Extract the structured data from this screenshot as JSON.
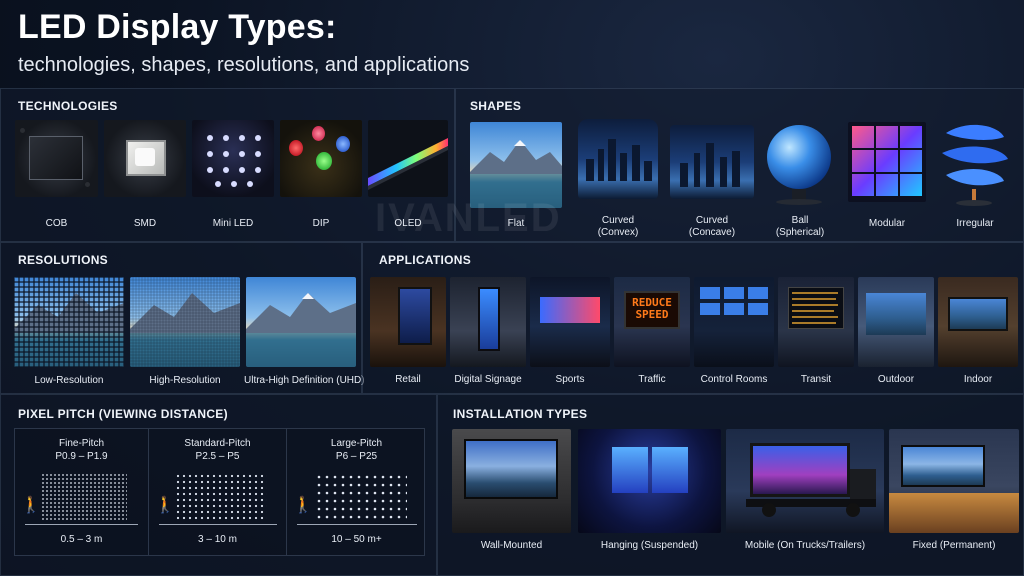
{
  "header": {
    "title": "LED Display Types:",
    "subtitle": "technologies, shapes, resolutions, and applications"
  },
  "watermark": "IVANLED",
  "technologies": {
    "title": "TECHNOLOGIES",
    "items": [
      {
        "label": "COB",
        "icon": "cob-chip-icon"
      },
      {
        "label": "SMD",
        "icon": "smd-chip-icon"
      },
      {
        "label": "Mini LED",
        "icon": "mini-led-icon"
      },
      {
        "label": "DIP",
        "icon": "dip-led-icon"
      },
      {
        "label": "OLED",
        "icon": "oled-panel-icon"
      }
    ]
  },
  "shapes": {
    "title": "SHAPES",
    "items": [
      {
        "label": "Flat",
        "sub": ""
      },
      {
        "label": "Curved",
        "sub": "(Convex)"
      },
      {
        "label": "Curved",
        "sub": "(Concave)"
      },
      {
        "label": "Ball",
        "sub": "(Spherical)"
      },
      {
        "label": "Modular",
        "sub": ""
      },
      {
        "label": "Irregular",
        "sub": ""
      }
    ]
  },
  "resolutions": {
    "title": "RESOLUTIONS",
    "items": [
      {
        "label": "Low-Resolution"
      },
      {
        "label": "High-Resolution"
      },
      {
        "label": "Ultra-High Definition (UHD)"
      }
    ]
  },
  "applications": {
    "title": "APPLICATIONS",
    "items": [
      {
        "label": "Retail"
      },
      {
        "label": "Digital Signage"
      },
      {
        "label": "Sports"
      },
      {
        "label": "Traffic"
      },
      {
        "label": "Control Rooms"
      },
      {
        "label": "Transit"
      },
      {
        "label": "Outdoor"
      },
      {
        "label": "Indoor"
      }
    ],
    "traffic_sign": "REDUCE SPEED"
  },
  "pixel_pitch": {
    "title": "PIXEL PITCH (VIEWING DISTANCE)",
    "columns": [
      {
        "name": "Fine-Pitch",
        "range": "P0.9 – P1.9",
        "distance": "0.5 – 3 m"
      },
      {
        "name": "Standard-Pitch",
        "range": "P2.5 – P5",
        "distance": "3 – 10 m"
      },
      {
        "name": "Large-Pitch",
        "range": "P6 – P25",
        "distance": "10 – 50 m+"
      }
    ]
  },
  "installation": {
    "title": "INSTALLATION TYPES",
    "items": [
      {
        "label": "Wall-Mounted"
      },
      {
        "label": "Hanging (Suspended)"
      },
      {
        "label": "Mobile (On Trucks/Trailers)"
      },
      {
        "label": "Fixed (Permanent)"
      }
    ]
  }
}
